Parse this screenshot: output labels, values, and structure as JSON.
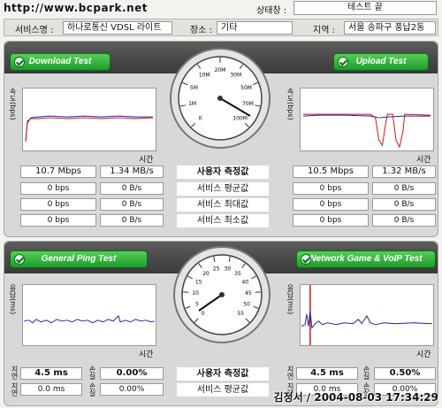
{
  "header": {
    "watermark": "http://www.bcpark.net",
    "status_label": "상태창 :",
    "status_value": "테스트 끝",
    "service_label": "서비스명 :",
    "service_value": "하나로통신 VDSL 라이트",
    "place_label": "장소 :",
    "place_value": "기타",
    "region_label": "지역 :",
    "region_value": "서울 송파구 풍납2동"
  },
  "speed": {
    "download_title": "Download Test",
    "upload_title": "Upload Test",
    "y_axis_label": "속도(bps)",
    "x_axis_label": "시간",
    "rows": [
      {
        "label": "사용자 측정값",
        "dl_bps": "10.7 Mbps",
        "dl_Bps": "1.34 MB/s",
        "ul_bps": "10.5 Mbps",
        "ul_Bps": "1.32 MB/s"
      },
      {
        "label": "서비스 평균값",
        "dl_bps": "0 bps",
        "dl_Bps": "0 B/s",
        "ul_bps": "0 bps",
        "ul_Bps": "0 B/s"
      },
      {
        "label": "서비스 최대값",
        "dl_bps": "0 bps",
        "dl_Bps": "0 B/s",
        "ul_bps": "0 bps",
        "ul_Bps": "0 B/s"
      },
      {
        "label": "서비스 최소값",
        "dl_bps": "0 bps",
        "dl_Bps": "0 B/s",
        "ul_bps": "0 bps",
        "ul_Bps": "0 B/s"
      }
    ],
    "gauge_ticks": [
      "0",
      "1M",
      "5M",
      "10M",
      "20M",
      "30M",
      "50M",
      "70M",
      "100M"
    ],
    "gauge_value": "10.7 Mbps"
  },
  "ping": {
    "ping_title": "General Ping Test",
    "game_title": "Network Game & VoIP Test",
    "y_axis_label": "응답(ms)",
    "x_axis_label": "시간",
    "latency_label": "지연",
    "loss_label": "손실",
    "rows": [
      {
        "label": "사용자 측정값",
        "ping_ms": "4.5 ms",
        "ping_loss": "0.00%",
        "game_ms": "4.5 ms",
        "game_loss": "0.50%"
      },
      {
        "label": "서비스 평균값",
        "ping_ms": "0.0 ms",
        "ping_loss": "0.00%",
        "game_ms": "0.0 ms",
        "game_loss": "0.00%"
      }
    ],
    "gauge_ticks": [
      "0",
      "5",
      "10",
      "15",
      "20",
      "25",
      "30",
      "35",
      "40",
      "45",
      "50",
      "55"
    ],
    "gauge_value": "4.5 ms"
  },
  "footer_credit": "김정서 / 2004-08-03 17:34:29"
}
